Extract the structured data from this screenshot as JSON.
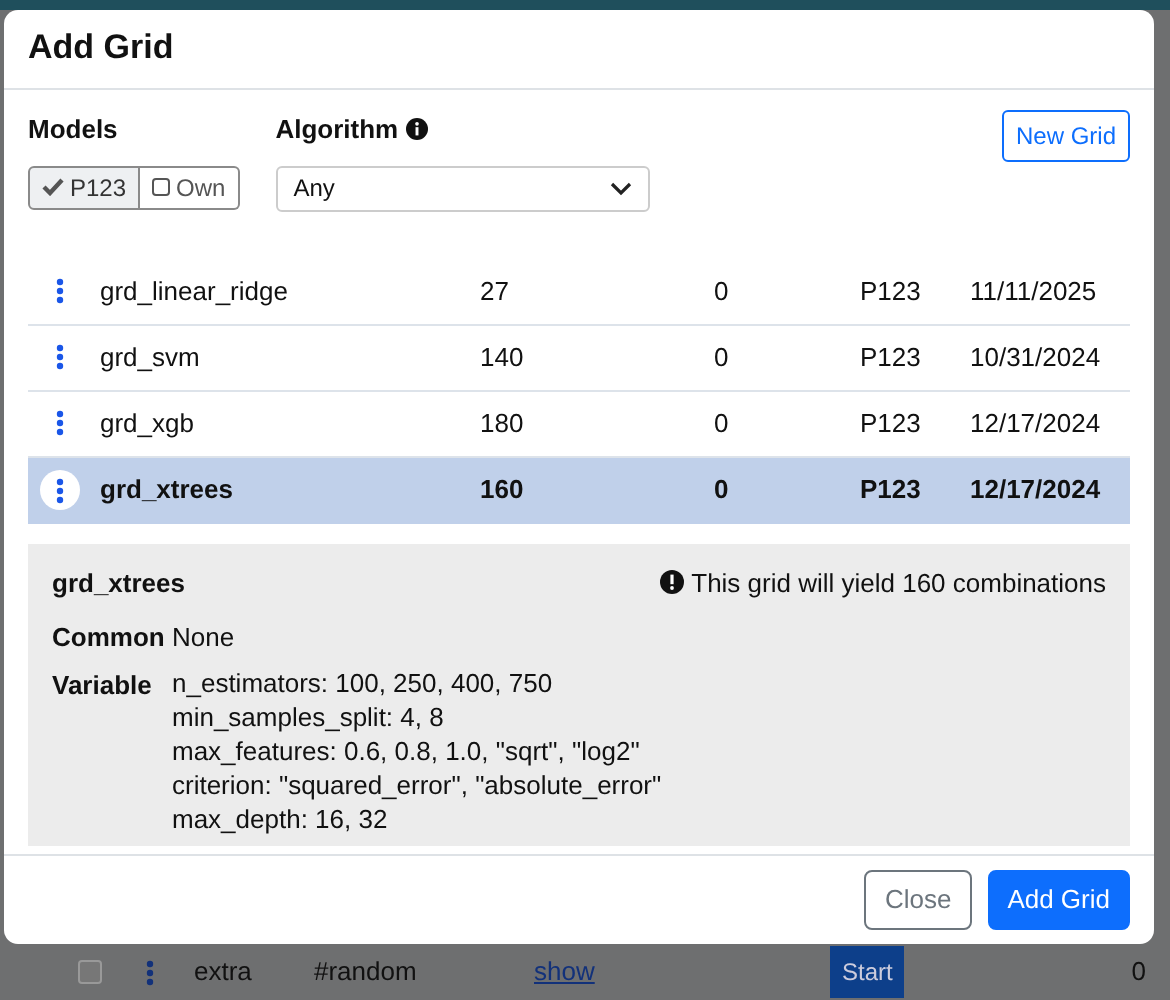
{
  "modal": {
    "title": "Add Grid",
    "models_label": "Models",
    "model_filters": [
      {
        "label": "P123",
        "selected": true
      },
      {
        "label": "Own",
        "selected": false
      }
    ],
    "algorithm_label": "Algorithm",
    "algorithm_value": "Any",
    "new_button": "New Grid"
  },
  "grids": [
    {
      "name": "grd_linear_ridge",
      "combinations": "27",
      "column_3": "0",
      "owner": "P123",
      "date": "11/11/2025",
      "selected": false
    },
    {
      "name": "grd_svm",
      "combinations": "140",
      "column_3": "0",
      "owner": "P123",
      "date": "10/31/2024",
      "selected": false
    },
    {
      "name": "grd_xgb",
      "combinations": "180",
      "column_3": "0",
      "owner": "P123",
      "date": "12/17/2024",
      "selected": false
    },
    {
      "name": "grd_xtrees",
      "combinations": "160",
      "column_3": "0",
      "owner": "P123",
      "date": "12/17/2024",
      "selected": true
    }
  ],
  "detail": {
    "name": "grd_xtrees",
    "notice": "This grid will yield 160 combinations",
    "common_label": "Common",
    "common_value": "None",
    "variable_label": "Variable",
    "variable_lines": [
      "n_estimators: 100, 250, 400, 750",
      "min_samples_split: 4, 8",
      "max_features: 0.6, 0.8, 1.0, \"sqrt\", \"log2\"",
      "criterion: \"squared_error\", \"absolute_error\"",
      "max_depth: 16, 32"
    ]
  },
  "footer_buttons": [
    {
      "label": "Close",
      "kind": "secondary"
    },
    {
      "label": "Add Grid",
      "kind": "primary"
    }
  ],
  "background_row": {
    "checked": false,
    "name": "extra",
    "tag": "#random",
    "link": "show",
    "button": "Start",
    "count": "0"
  }
}
